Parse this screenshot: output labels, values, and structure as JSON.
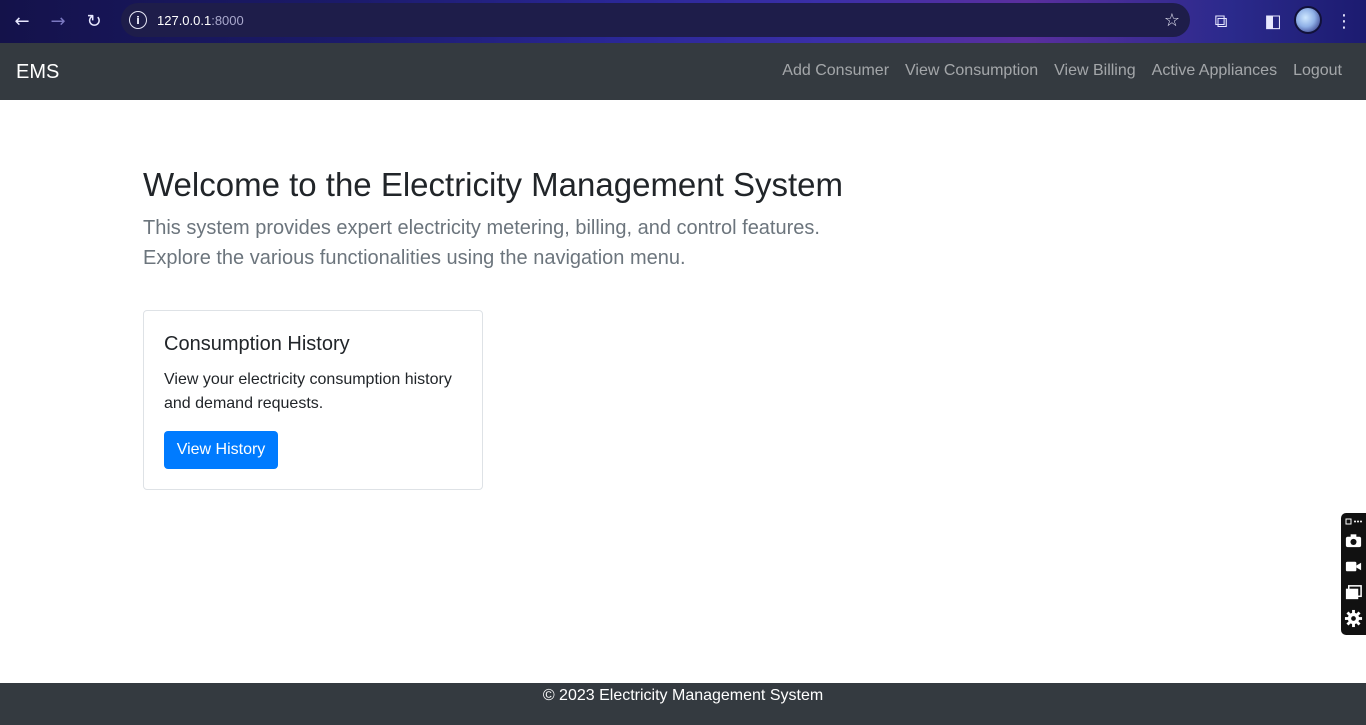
{
  "browser": {
    "back_icon": "←",
    "forward_icon": "→",
    "reload_icon": "↻",
    "site_info_icon": "i",
    "url_host": "127.0.0.1",
    "url_port": ":8000",
    "bookmark_icon": "☆",
    "extensions_icon": "⧉",
    "sidepanel_icon": "◧",
    "menu_icon": "⋮"
  },
  "navbar": {
    "brand": "EMS",
    "links": [
      {
        "label": "Add Consumer"
      },
      {
        "label": "View Consumption"
      },
      {
        "label": "View Billing"
      },
      {
        "label": "Active Appliances"
      },
      {
        "label": "Logout"
      }
    ]
  },
  "hero": {
    "title": "Welcome to the Electricity Management System",
    "lead": "This system provides expert electricity metering, billing, and control features. Explore the various functionalities using the navigation menu."
  },
  "card": {
    "title": "Consumption History",
    "text": "View your electricity consumption history and demand requests.",
    "button": "View History",
    "button_color": "#007bff"
  },
  "footer": {
    "text": "© 2023 Electricity Management System"
  },
  "side_widget": {
    "icons": [
      "camera-icon",
      "video-icon",
      "window-icon",
      "settings-icon"
    ]
  }
}
